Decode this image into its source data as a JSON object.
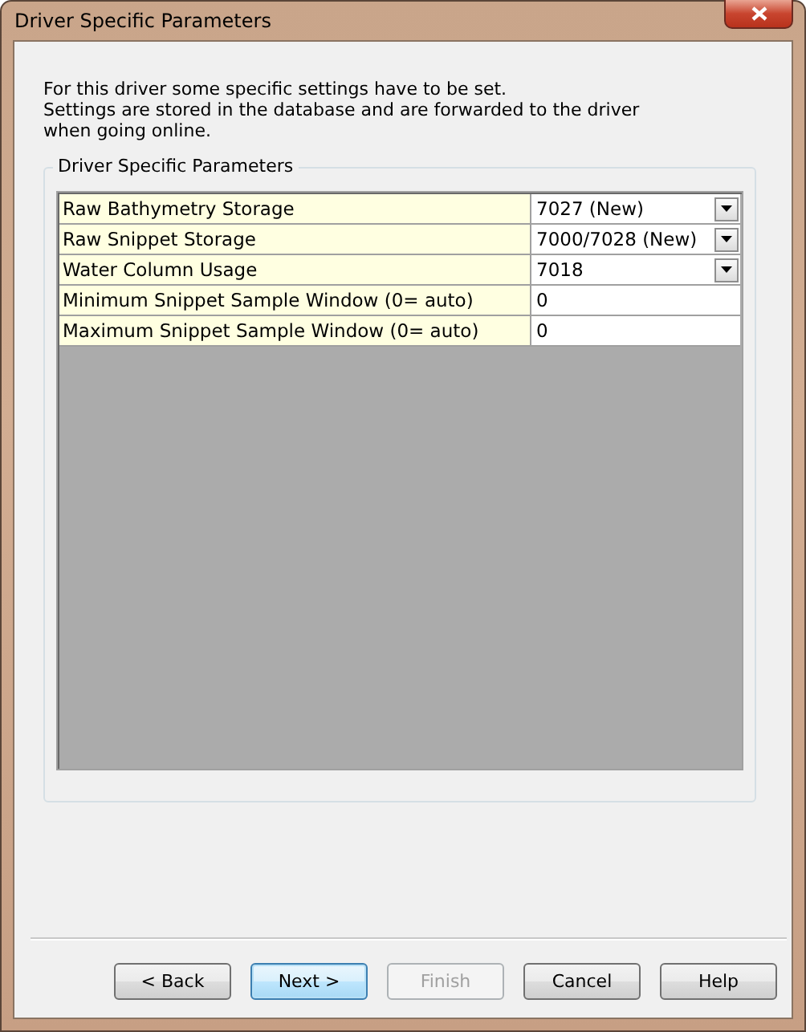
{
  "window": {
    "title": "Driver Specific Parameters"
  },
  "intro": [
    "For this driver some specific settings have to be set.",
    "Settings are stored in the database and are forwarded to the driver when going online."
  ],
  "group": {
    "title": "Driver Specific Parameters",
    "rows": [
      {
        "label": "Raw Bathymetry Storage",
        "value": "7027 (New)",
        "kind": "dropdown"
      },
      {
        "label": "Raw Snippet Storage",
        "value": "7000/7028 (New)",
        "kind": "dropdown"
      },
      {
        "label": "Water Column Usage",
        "value": "7018",
        "kind": "dropdown"
      },
      {
        "label": "Minimum Snippet Sample Window (0= auto)",
        "value": "0",
        "kind": "text"
      },
      {
        "label": "Maximum Snippet Sample Window (0= auto)",
        "value": "0",
        "kind": "text"
      }
    ]
  },
  "buttons": [
    {
      "label": "< Back",
      "default": false,
      "disabled": false
    },
    {
      "label": "Next >",
      "default": true,
      "disabled": false
    },
    {
      "label": "Finish",
      "default": false,
      "disabled": true
    },
    {
      "label": "Cancel",
      "default": false,
      "disabled": false
    },
    {
      "label": "Help",
      "default": false,
      "disabled": false
    }
  ]
}
